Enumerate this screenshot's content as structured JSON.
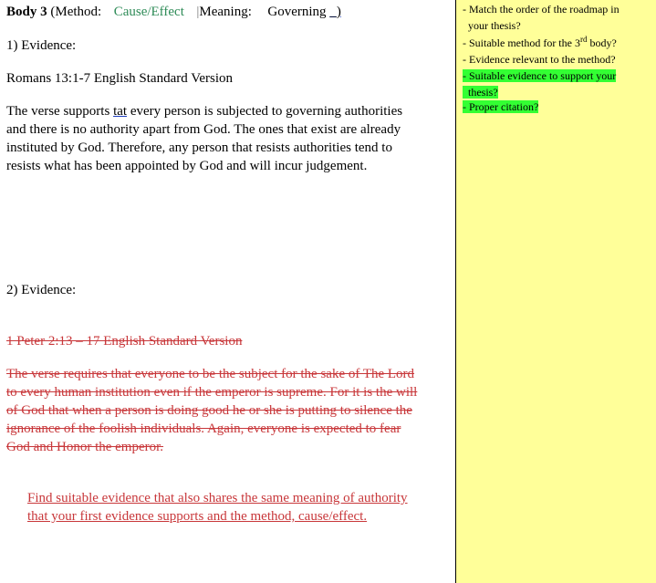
{
  "body_heading": {
    "label": "Body 3",
    "method_label": "(Method:",
    "method_value": "Cause/Effect",
    "bar": "|",
    "meaning_label": "Meaning:",
    "meaning_value": "Governing",
    "blank": "_)"
  },
  "evidence1": {
    "label": "1)  Evidence:",
    "source": "Romans 13:1-7 English Standard Version",
    "para_lines": [
      "The verse supports ",
      "tat",
      " every person is subjected to governing authorities",
      "and there is no authority apart from God. The ones that exist are already",
      "instituted by God. Therefore, any person that resists authorities tend to",
      "resists what has been appointed by God and will incur judgement."
    ]
  },
  "evidence2": {
    "label": "2)  Evidence:",
    "source_deleted": "1 Peter 2:13 – 17 English Standard Version",
    "para_deleted": [
      "The verse requires that everyone to be the subject for the sake of The Lord",
      "to every human institution even if the emperor is supreme. For it is the will",
      "of God that when a person is doing good he or she is putting to silence the",
      "ignorance of the foolish individuals. Again, everyone is expected to fear",
      "God and Honor the emperor."
    ],
    "inserted_note": [
      "Find suitable evidence that also shares the same meaning of authority",
      "that your first evidence supports and the method, cause/effect. "
    ]
  },
  "sidebar": {
    "items": [
      {
        "line1": "- Match the order of the roadmap in",
        "line2": "your thesis?",
        "highlight": false
      },
      {
        "pre": "- Suitable method for the 3",
        "sup": "rd",
        "post": " body?",
        "highlight": false
      },
      {
        "line1": "- Evidence relevant to the method?",
        "highlight": false
      },
      {
        "line1": "- Suitable evidence to support your",
        "line2": "thesis?",
        "highlight": true
      },
      {
        "line1": "- Proper citation?",
        "highlight": true
      }
    ]
  },
  "colors": {
    "sidebar_bg": "#ffff99",
    "highlight": "#33ff33",
    "revision_red": "#c8373a",
    "method_green": "#2e8b57"
  }
}
